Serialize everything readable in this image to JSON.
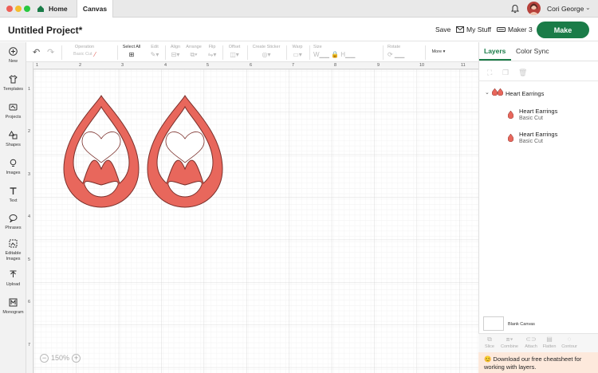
{
  "window": {
    "tabs": {
      "home": "Home",
      "canvas": "Canvas"
    }
  },
  "user": {
    "name": "Cori George"
  },
  "header": {
    "project_title": "Untitled Project*",
    "save": "Save",
    "my_stuff": "My Stuff",
    "machine": "Maker 3",
    "make": "Make"
  },
  "toolbar": {
    "operation": "Operation",
    "operation_value": "Basic Cut",
    "select_all": "Select All",
    "edit": "Edit",
    "align": "Align",
    "arrange": "Arrange",
    "flip": "Flip",
    "offset": "Offset",
    "create_sticker": "Create Sticker",
    "warp": "Warp",
    "size": "Size",
    "rotate": "Rotate",
    "more": "More"
  },
  "sidebar": {
    "items": [
      {
        "label": "New",
        "icon": "plus-circle-icon"
      },
      {
        "label": "Templates",
        "icon": "shirt-icon"
      },
      {
        "label": "Projects",
        "icon": "projects-icon"
      },
      {
        "label": "Shapes",
        "icon": "shapes-icon"
      },
      {
        "label": "Images",
        "icon": "bulb-icon"
      },
      {
        "label": "Text",
        "icon": "text-icon"
      },
      {
        "label": "Phrases",
        "icon": "speech-icon"
      },
      {
        "label": "Editable Images",
        "icon": "editable-image-icon"
      },
      {
        "label": "Upload",
        "icon": "upload-icon"
      },
      {
        "label": "Monogram",
        "icon": "monogram-icon"
      }
    ]
  },
  "rulers": {
    "top": [
      "1",
      "2",
      "3",
      "4",
      "5",
      "6",
      "7",
      "8",
      "9",
      "10",
      "11"
    ],
    "left": [
      "1",
      "2",
      "3",
      "4",
      "5",
      "6",
      "7"
    ]
  },
  "zoom": {
    "value": "150%"
  },
  "layers_panel": {
    "tabs": {
      "layers": "Layers",
      "color_sync": "Color Sync"
    },
    "group": {
      "name": "Heart Earrings"
    },
    "layers": [
      {
        "name": "Heart Earrings",
        "type": "Basic Cut"
      },
      {
        "name": "Heart Earrings",
        "type": "Basic Cut"
      }
    ],
    "blank_canvas": "Blank Canvas",
    "bottom_tools": [
      "Slice",
      "Combine",
      "Attach",
      "Flatten",
      "Contour"
    ],
    "promo": "😊 Download our free cheatsheet for working with layers."
  },
  "colors": {
    "accent": "#1a7c48",
    "shape_fill": "#e8675c",
    "shape_stroke": "#7a2f2a",
    "promo_bg": "#fde9dc"
  }
}
